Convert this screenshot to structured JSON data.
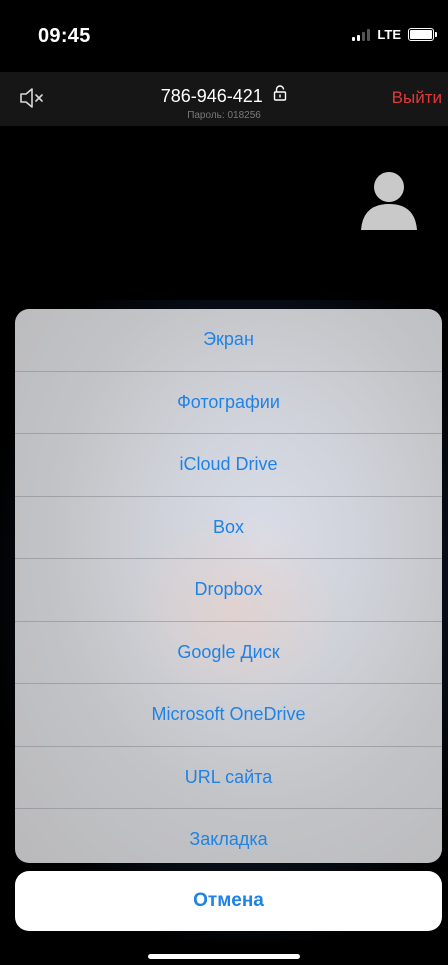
{
  "status_bar": {
    "time": "09:45",
    "network": "LTE"
  },
  "header": {
    "meeting_id": "786-946-421",
    "password_label": "Пароль: 018256",
    "leave_label": "Выйти"
  },
  "icons": {
    "speaker": "speaker-muted-icon",
    "lock": "lock-icon",
    "avatar": "person-avatar-icon"
  },
  "action_sheet": {
    "items": [
      {
        "label": "Экран"
      },
      {
        "label": "Фотографии"
      },
      {
        "label": "iCloud Drive"
      },
      {
        "label": "Box"
      },
      {
        "label": "Dropbox"
      },
      {
        "label": "Google Диск"
      },
      {
        "label": "Microsoft OneDrive"
      },
      {
        "label": "URL сайта"
      },
      {
        "label": "Закладка"
      }
    ],
    "cancel_label": "Отмена"
  },
  "colors": {
    "accent": "#1f82e6",
    "leave": "#e0383a"
  }
}
